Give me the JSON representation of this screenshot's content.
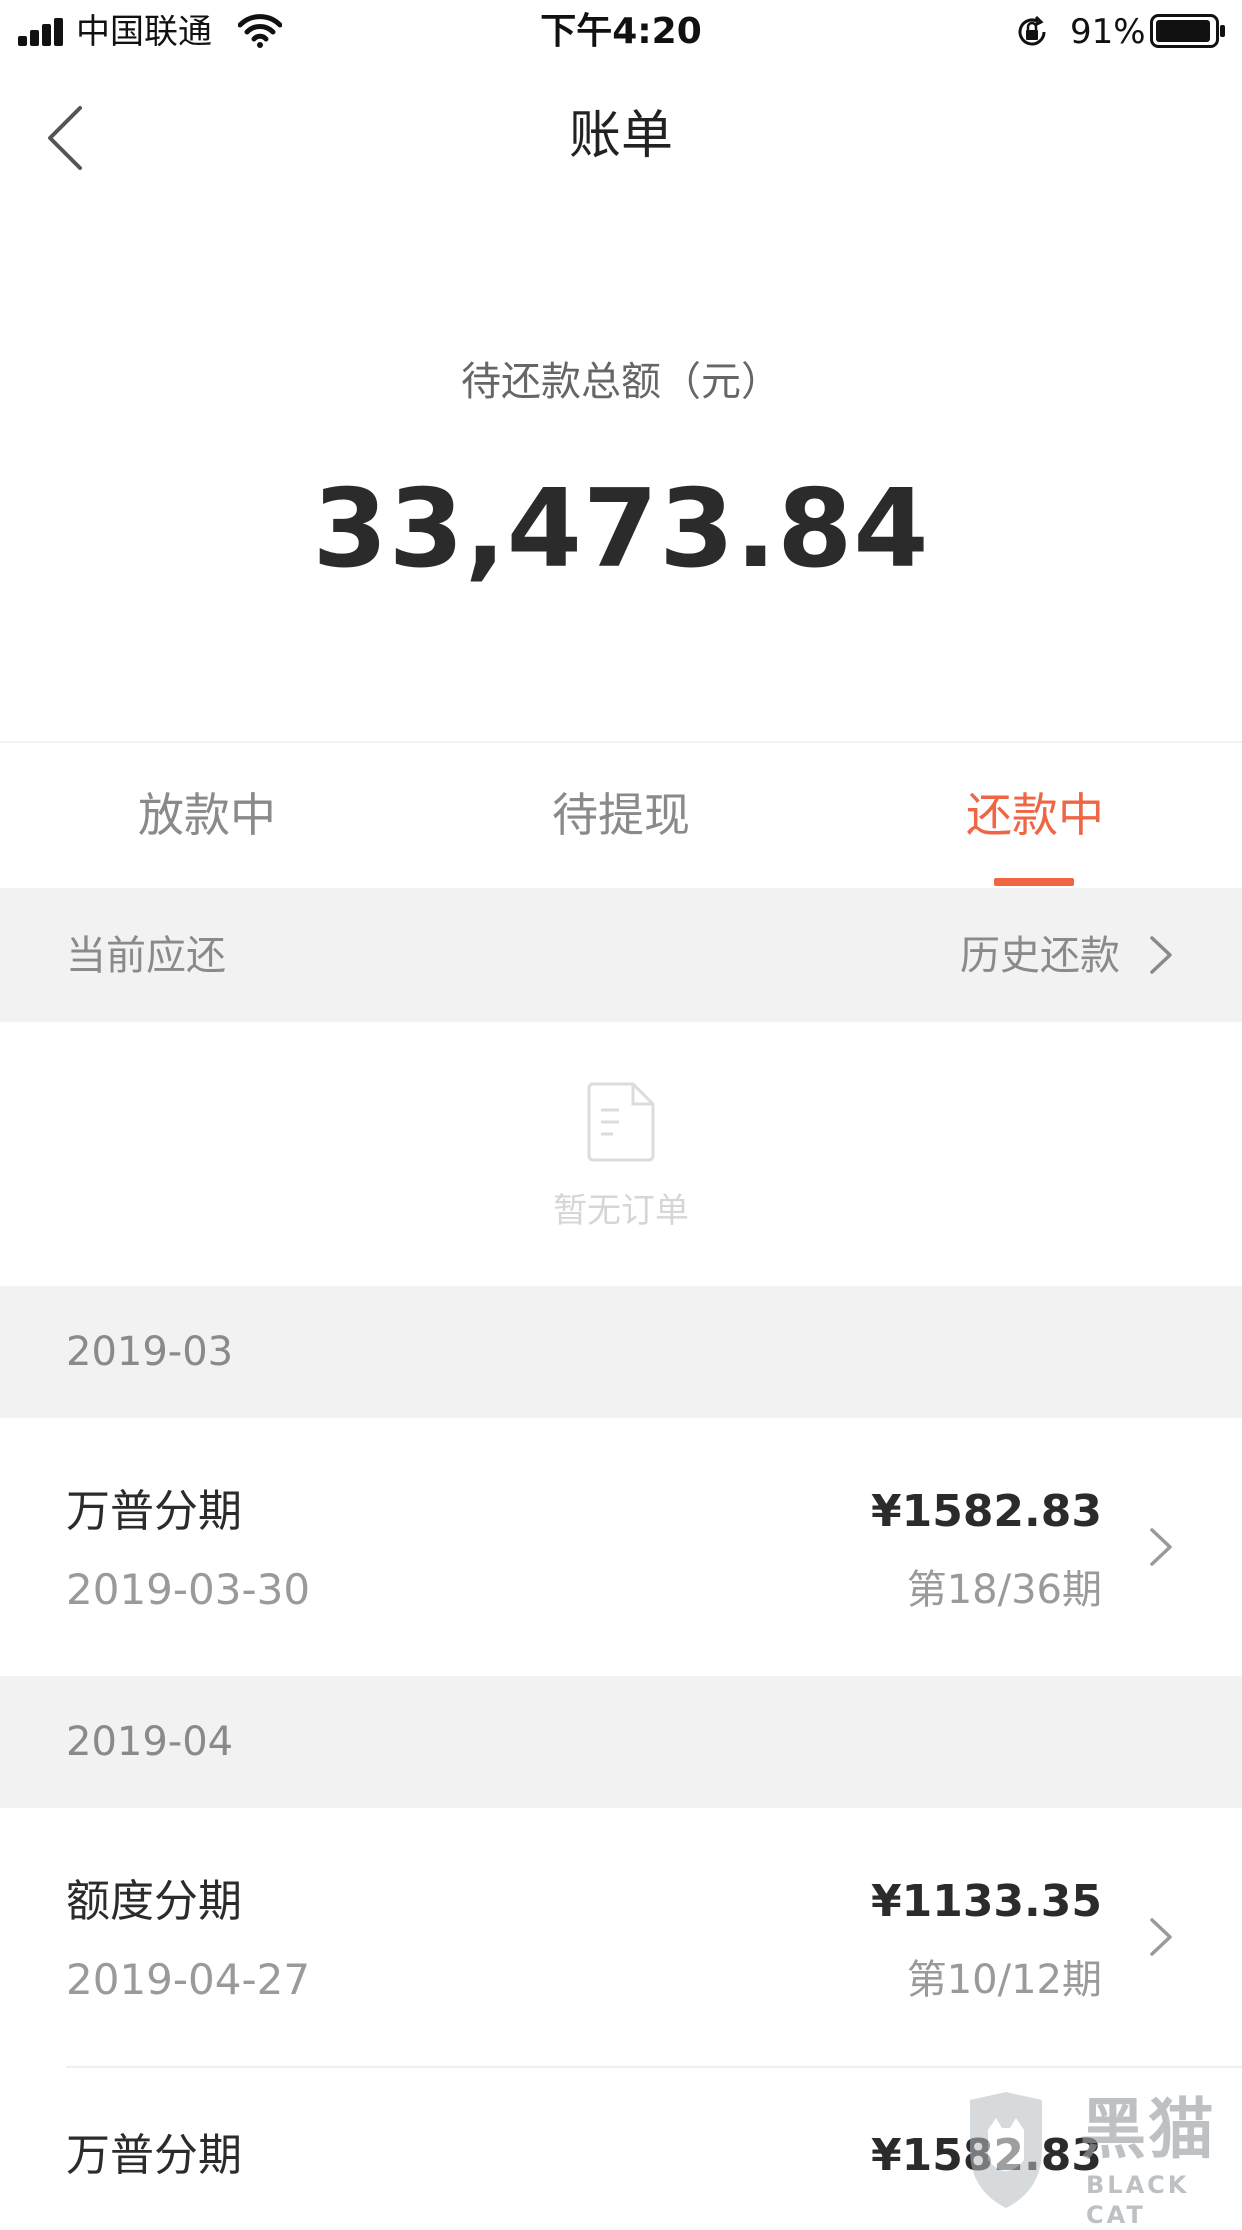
{
  "status_bar": {
    "carrier": "中国联通",
    "time": "下午4:20",
    "battery": "91%"
  },
  "nav": {
    "title": "账单",
    "back_icon": "chevron-left-icon"
  },
  "summary": {
    "label": "待还款总额（元）",
    "amount": "33,473.84"
  },
  "tabs": [
    {
      "label": "放款中",
      "active": false
    },
    {
      "label": "待提现",
      "active": false
    },
    {
      "label": "还款中",
      "active": true
    }
  ],
  "accent_color": "#f06543",
  "current": {
    "label": "当前应还",
    "history_link": "历史还款",
    "empty_text": "暂无订单",
    "empty_icon": "document-icon"
  },
  "groups": [
    {
      "month": "2019-03",
      "items": [
        {
          "name": "万普分期",
          "date": "2019-03-30",
          "amount": "¥1582.83",
          "period": "第18/36期"
        }
      ]
    },
    {
      "month": "2019-04",
      "items": [
        {
          "name": "额度分期",
          "date": "2019-04-27",
          "amount": "¥1133.35",
          "period": "第10/12期"
        },
        {
          "name": "万普分期",
          "date": "",
          "amount": "¥1582.83",
          "period": ""
        }
      ]
    }
  ],
  "watermark": {
    "cn": "黑猫",
    "en": "BLACK CAT"
  }
}
